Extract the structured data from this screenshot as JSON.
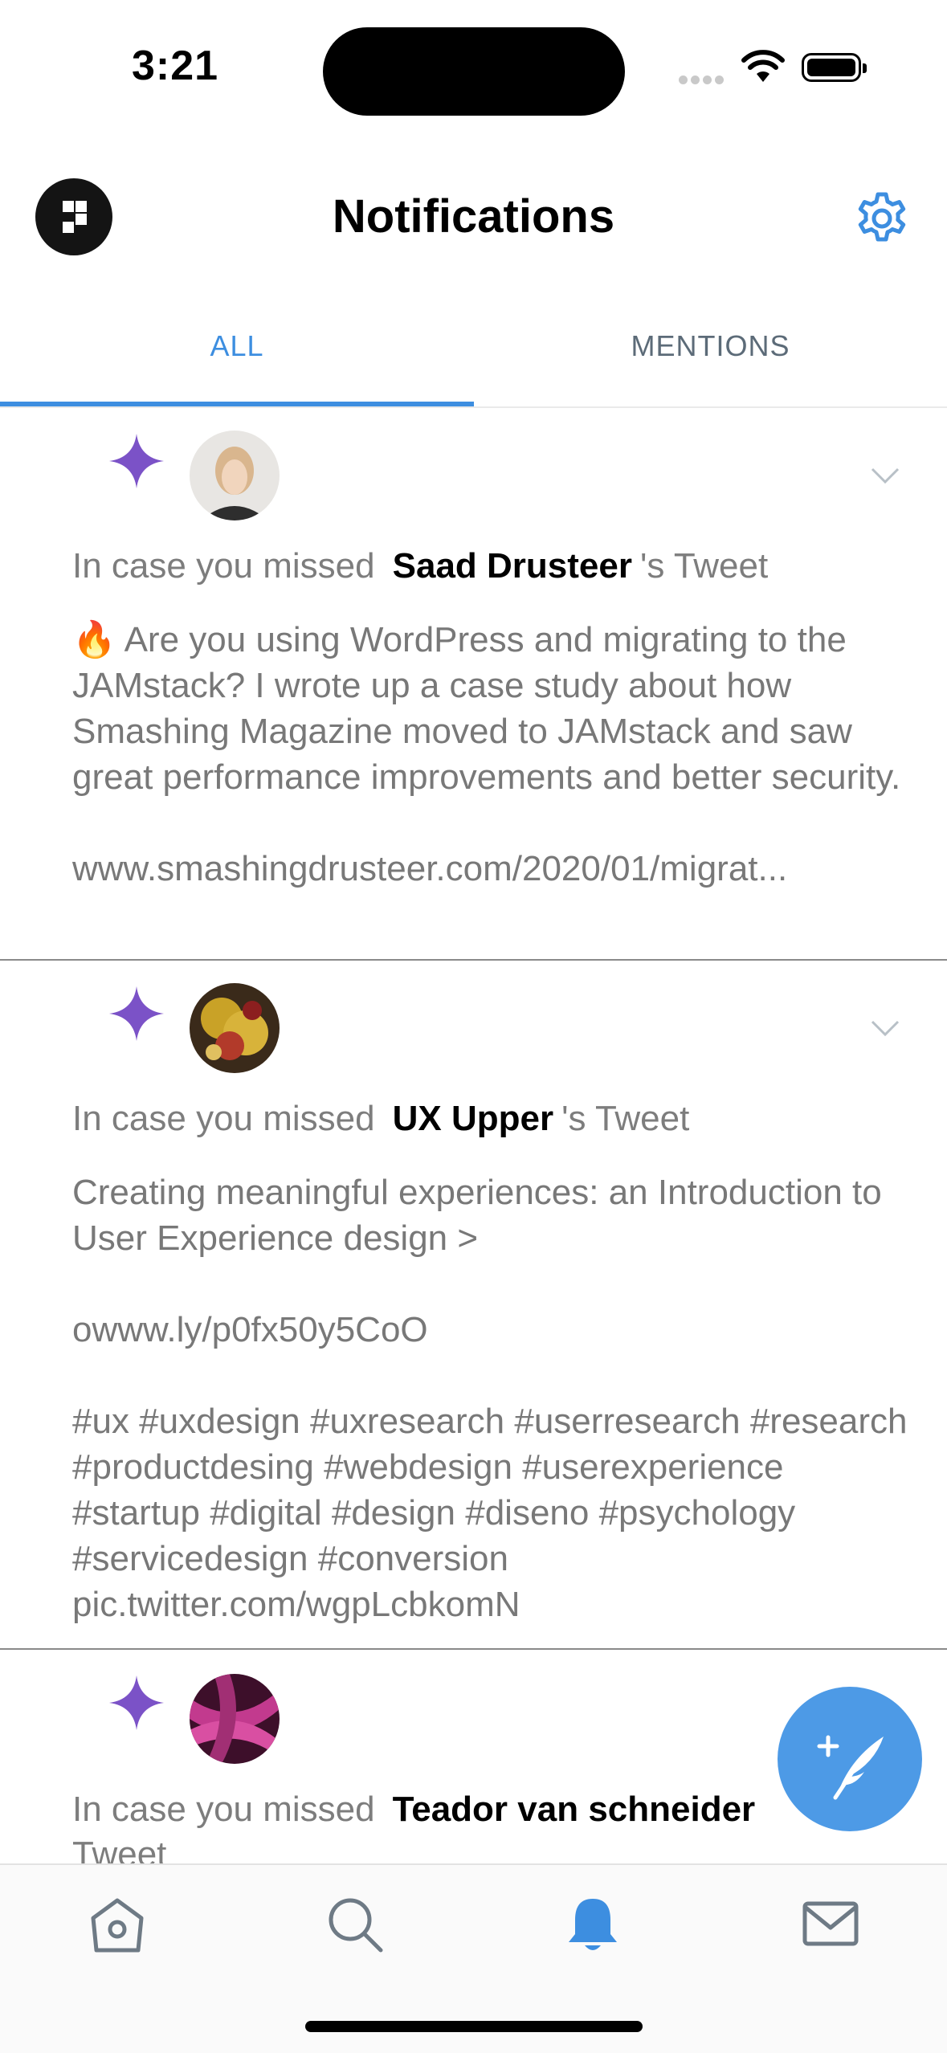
{
  "status_bar": {
    "time": "3:21"
  },
  "header": {
    "title": "Notifications"
  },
  "tabs": [
    {
      "label": "ALL",
      "active": true
    },
    {
      "label": "MENTIONS",
      "active": false
    }
  ],
  "notifications": [
    {
      "prefix": "In case you missed",
      "name": "Saad Drusteer",
      "suffix": "'s Tweet",
      "body": "🔥 Are you using WordPress and migrating to the JAMstack? I wrote up a case study about how Smashing Magazine moved to JAMstack and saw great performance improvements and better security.\n\nwww.smashingdrusteer.com/2020/01/migrat..."
    },
    {
      "prefix": "In case you missed",
      "name": "UX Upper",
      "suffix": "'s Tweet",
      "body": "Creating meaningful experiences: an Introduction to User Experience design >\n\nowww.ly/p0fx50y5CoO\n\n#ux #uxdesign #uxresearch #userresearch #research #productdesing #webdesign #userexperience #startup #digital #design #diseno #psychology #servicedesign #conversion pic.twitter.com/wgpLcbkomN"
    },
    {
      "prefix": "In case you missed",
      "name": "Teador van schneider",
      "suffix": "'s Tweet",
      "suffix_wrapped": "Tweet"
    }
  ],
  "colors": {
    "accent": "#3d8ee0",
    "sparkle": "#7b52c7",
    "fab": "#4d9ae6"
  },
  "bottom_nav": [
    "home-icon",
    "search-icon",
    "bell-icon",
    "mail-icon"
  ]
}
